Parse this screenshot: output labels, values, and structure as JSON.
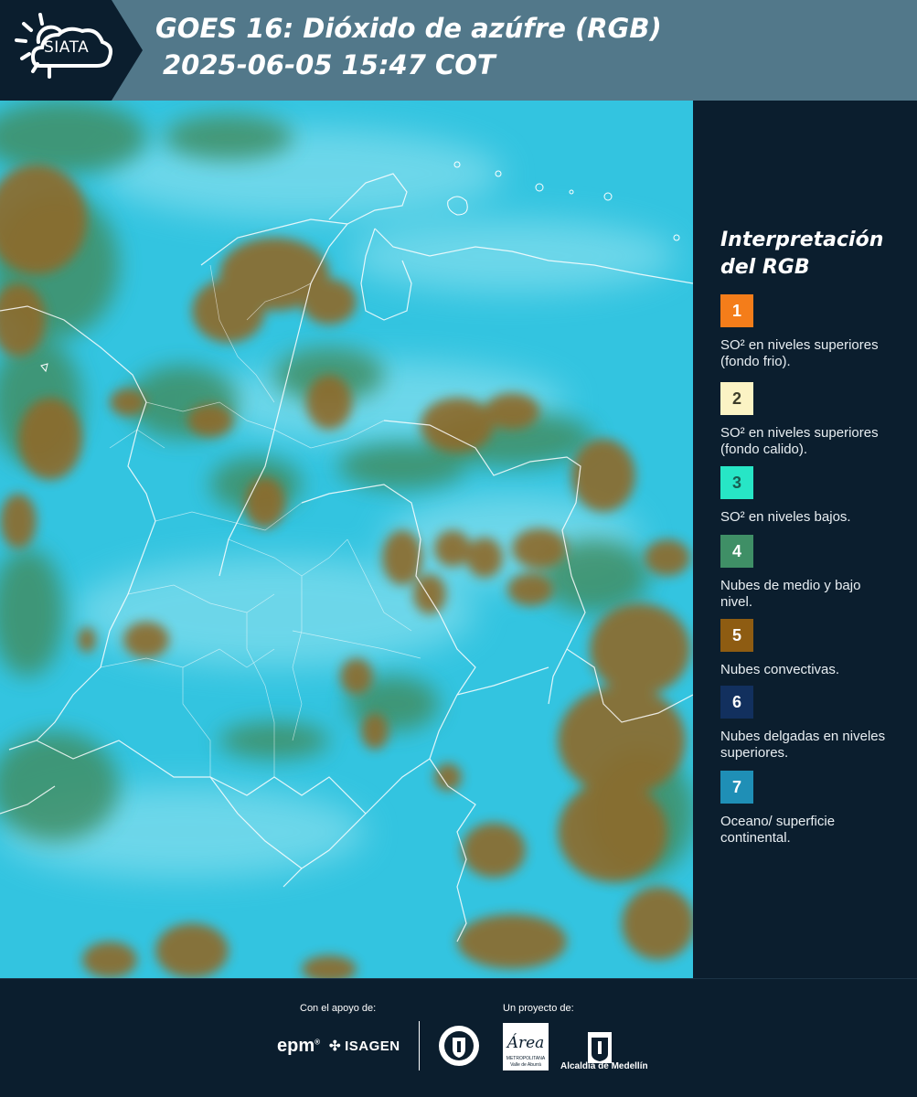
{
  "header": {
    "logo_text": "SIATA",
    "title_line1": "GOES 16: Dióxido de azúfre (RGB)",
    "title_line2": "2025-06-05 15:47 COT"
  },
  "legend": {
    "title_line1": "Interpretación",
    "title_line2": "del RGB",
    "items": [
      {
        "number": "1",
        "color": "#f47d1a",
        "text_color": "#ffffff",
        "label": "SO² en niveles superiores (fondo frio)."
      },
      {
        "number": "2",
        "color": "#fbf3c4",
        "text_color": "#3d3d2a",
        "label": "SO² en niveles superiores (fondo calido)."
      },
      {
        "number": "3",
        "color": "#27e6c6",
        "text_color": "#175e52",
        "label": "SO² en niveles bajos."
      },
      {
        "number": "4",
        "color": "#3f8f66",
        "text_color": "#ffffff",
        "label": "Nubes de medio y bajo nivel."
      },
      {
        "number": "5",
        "color": "#8e5c12",
        "text_color": "#ffffff",
        "label": "Nubes convectivas."
      },
      {
        "number": "6",
        "color": "#12305e",
        "text_color": "#ffffff",
        "label": "Nubes delgadas en niveles superiores."
      },
      {
        "number": "7",
        "color": "#1f8fb6",
        "text_color": "#ffffff",
        "label": "Oceano/ superficie continental."
      }
    ]
  },
  "map": {
    "surface_color": "#33c4e0",
    "convective_cloud_color": "#8e6a2c",
    "mid_cloud_color": "#3f8f66",
    "boundary_color": "#ffffff"
  },
  "footer": {
    "support_caption": "Con el apoyo de:",
    "project_caption": "Un proyecto de:",
    "epm_label": "epm",
    "isagen_label": "ISAGEN",
    "area_label": "Área",
    "area_sub1": "METROPOLITANA",
    "area_sub2": "Valle de Aburrá",
    "alcaldia_label": "Alcaldía de Medellín"
  }
}
